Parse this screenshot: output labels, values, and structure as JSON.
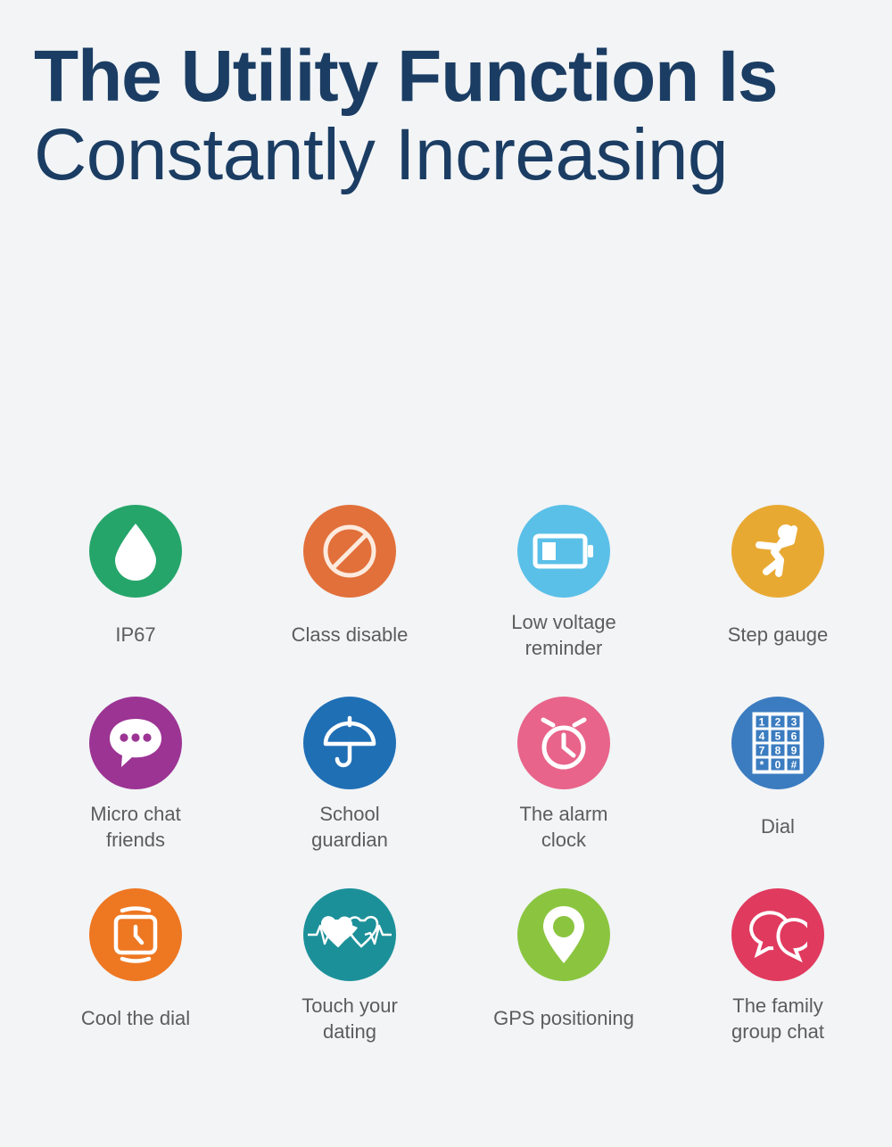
{
  "heading": {
    "line1": "The Utility Function Is",
    "line2": "Constantly Increasing",
    "color": "#1b3d63"
  },
  "page": {
    "background_color": "#f2f4f6",
    "label_color": "#5c5c5c"
  },
  "features": [
    {
      "label": "IP67",
      "icon": "water-drop-icon",
      "circle_color": "#25a56a",
      "icon_color": "#ffffff"
    },
    {
      "label": "Class disable",
      "icon": "no-entry-icon",
      "circle_color": "#e2703a",
      "icon_color": "#fdf0e6"
    },
    {
      "label": "Low voltage\nreminder",
      "icon": "battery-low-icon",
      "circle_color": "#5bc0e8",
      "icon_color": "#ffffff"
    },
    {
      "label": "Step gauge",
      "icon": "running-person-icon",
      "circle_color": "#e8a933",
      "icon_color": "#ffffff"
    },
    {
      "label": "Micro chat\nfriends",
      "icon": "chat-bubble-dots-icon",
      "circle_color": "#9c3494",
      "icon_color": "#ffffff"
    },
    {
      "label": "School\nguardian",
      "icon": "umbrella-icon",
      "circle_color": "#1f6fb5",
      "icon_color": "#ffffff"
    },
    {
      "label": "The alarm\nclock",
      "icon": "alarm-clock-icon",
      "circle_color": "#e8648a",
      "icon_color": "#ffffff"
    },
    {
      "label": "Dial",
      "icon": "dial-keypad-icon",
      "circle_color": "#3b7cc0",
      "icon_color": "#ffffff",
      "keypad": [
        "1",
        "2",
        "3",
        "4",
        "5",
        "6",
        "7",
        "8",
        "9",
        "*",
        "0",
        "#"
      ]
    },
    {
      "label": "Cool the dial",
      "icon": "smartwatch-icon",
      "circle_color": "#ee7722",
      "icon_color": "#ffffff"
    },
    {
      "label": "Touch your\ndating",
      "icon": "two-hearts-heartbeat-icon",
      "circle_color": "#1c9099",
      "icon_color": "#ffffff"
    },
    {
      "label": "GPS positioning",
      "icon": "location-pin-icon",
      "circle_color": "#8bc540",
      "icon_color": "#ffffff"
    },
    {
      "label": "The family\ngroup chat",
      "icon": "group-chat-bubbles-icon",
      "circle_color": "#e03a5e",
      "icon_color": "#ffffff"
    }
  ]
}
